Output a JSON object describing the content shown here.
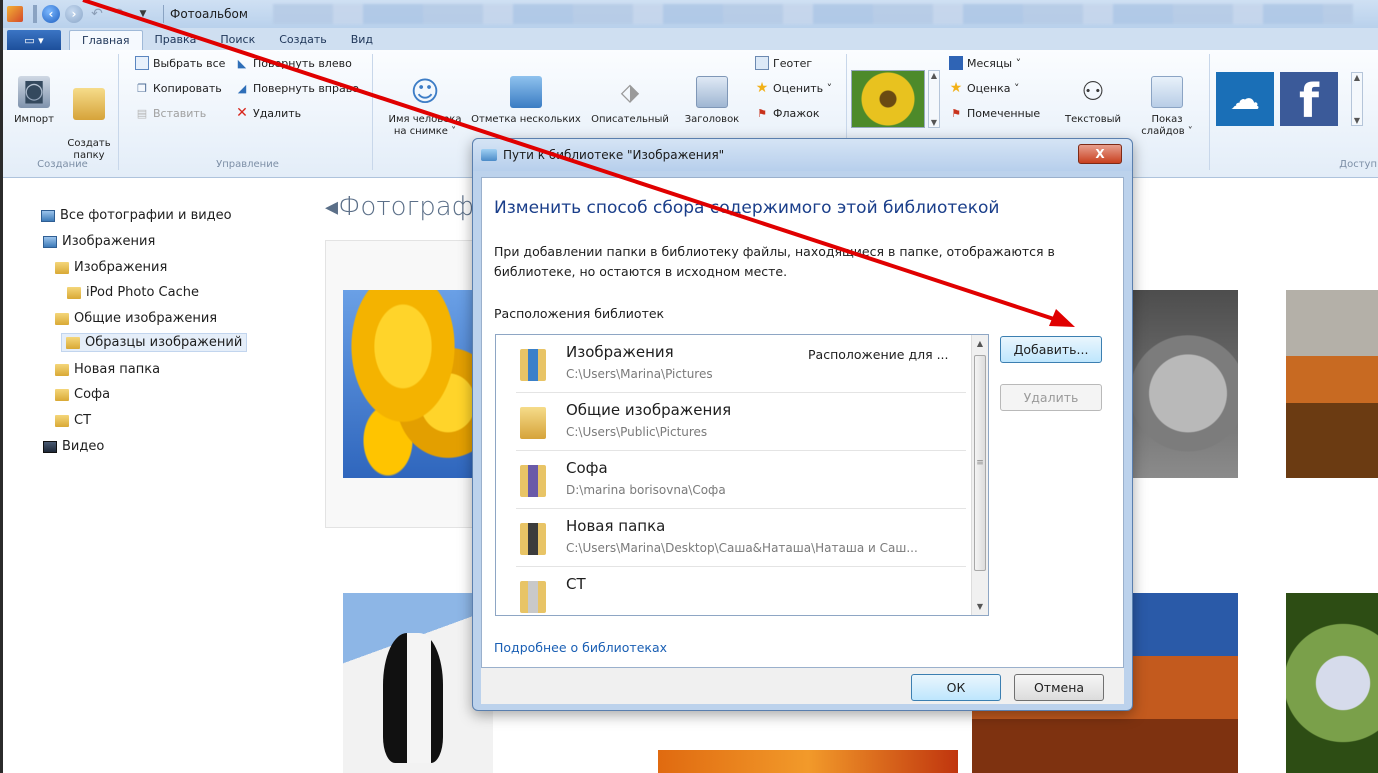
{
  "window": {
    "title": "Фотоальбом"
  },
  "tabs": {
    "file_label": "",
    "items": [
      {
        "label": "Главная"
      },
      {
        "label": "Правка"
      },
      {
        "label": "Поиск"
      },
      {
        "label": "Создать"
      },
      {
        "label": "Вид"
      }
    ]
  },
  "ribbon": {
    "create_group": {
      "label": "Создание",
      "import_label": "Импорт",
      "create_folder_label": "Создать\nпапку"
    },
    "manage_group": {
      "label": "Управление",
      "select_all": "Выбрать все",
      "copy": "Копировать",
      "paste": "Вставить",
      "rotate_left": "Повернуть влево",
      "rotate_right": "Повернуть вправо",
      "delete": "Удалить"
    },
    "organize": {
      "person_label": "Имя человека",
      "person_sub": "на снимке ˅",
      "tag_many": "Отметка нескольких",
      "descriptive": "Описательный",
      "caption": "Заголовок",
      "geotag": "Геотег",
      "rate": "Оценить ˅",
      "flag": "Флажок"
    },
    "view": {
      "months": "Месяцы ˅",
      "rating": "Оценка ˅",
      "flagged": "Помеченные",
      "text_label": "Текстовый",
      "slideshow_label": "Показ",
      "slideshow_sub": "слайдов ˅"
    },
    "share_group": {
      "label": "Доступ"
    }
  },
  "nav": {
    "items": [
      {
        "label": "Все фотографии и видео"
      },
      {
        "label": "Изображения"
      },
      {
        "label": "Изображения"
      },
      {
        "label": "iPod Photo Cache"
      },
      {
        "label": "Общие изображения"
      },
      {
        "label": "Образцы изображений"
      },
      {
        "label": "Новая папка"
      },
      {
        "label": "Софа"
      },
      {
        "label": "СТ"
      },
      {
        "label": "Видео"
      }
    ]
  },
  "content": {
    "section_title": "Фотограф"
  },
  "dialog": {
    "title": "Пути к библиотеке \"Изображения\"",
    "close_label": "X",
    "heading": "Изменить способ сбора содержимого этой библиотекой",
    "description": "При добавлении папки в библиотеку файлы, находящиеся в папке, отображаются в библиотеке, но остаются в исходном месте.",
    "list_label": "Расположения библиотек",
    "locations": [
      {
        "name": "Изображения",
        "path": "C:\\Users\\Marina\\Pictures",
        "note": "Расположение для ..."
      },
      {
        "name": "Общие изображения",
        "path": "C:\\Users\\Public\\Pictures",
        "note": ""
      },
      {
        "name": "Софа",
        "path": "D:\\marina borisovna\\Софа",
        "note": ""
      },
      {
        "name": "Новая папка",
        "path": "C:\\Users\\Marina\\Desktop\\Саша&Наташа\\Наташа и Саш...",
        "note": ""
      },
      {
        "name": "СТ",
        "path": "",
        "note": ""
      }
    ],
    "add_button": "Добавить...",
    "remove_button": "Удалить",
    "learn_more_link": "Подробнее о библиотеках",
    "ok_button": "ОК",
    "cancel_button": "Отмена"
  },
  "annotation": {
    "arrow_color": "#e00000"
  }
}
